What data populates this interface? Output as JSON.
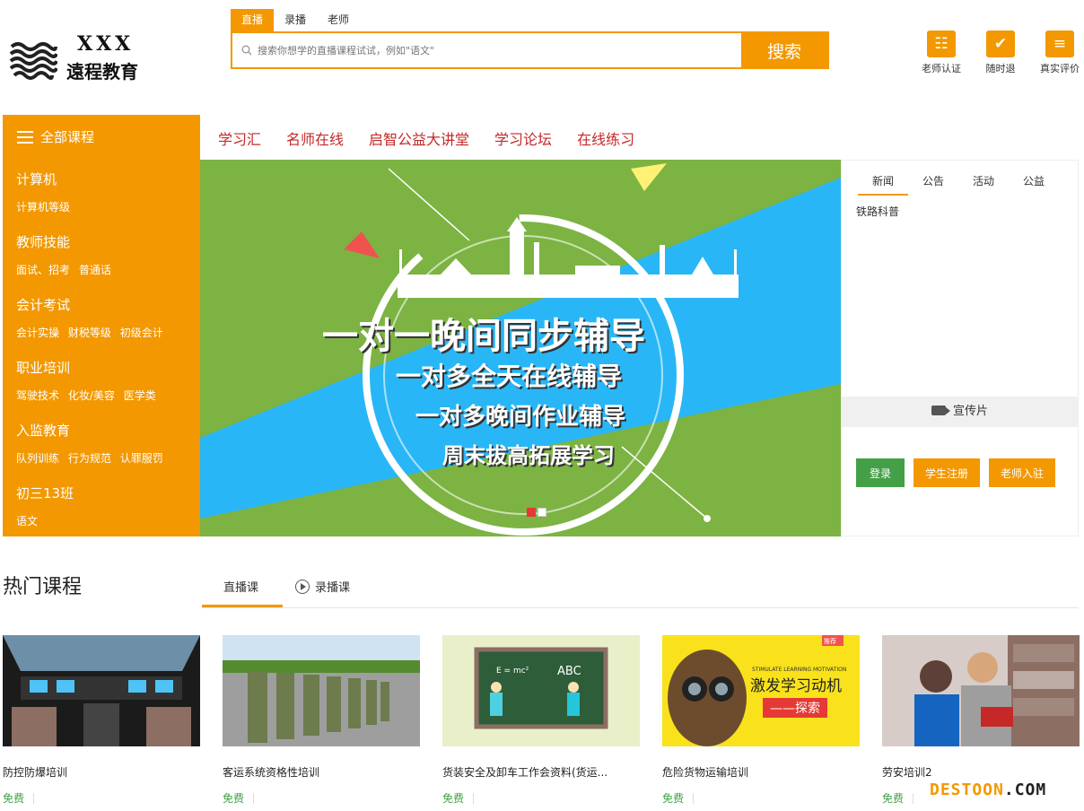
{
  "logo": {
    "line1": "XXX",
    "line2": "遠程教育"
  },
  "search": {
    "tabs": [
      "直播",
      "录播",
      "老师"
    ],
    "placeholder": "搜索你想学的直播课程试试，例如\"语文\"",
    "button": "搜索"
  },
  "features": [
    {
      "label": "老师认证",
      "icon": "teacher-certification-icon"
    },
    {
      "label": "随时退",
      "icon": "refund-icon"
    },
    {
      "label": "真实评价",
      "icon": "review-icon"
    }
  ],
  "nav": {
    "all_courses": "全部课程",
    "links": [
      "学习汇",
      "名师在线",
      "启智公益大讲堂",
      "学习论坛",
      "在线练习"
    ]
  },
  "sidebar": {
    "categories": [
      {
        "title": "计算机",
        "subs": [
          "计算机等级"
        ]
      },
      {
        "title": "教师技能",
        "subs": [
          "面试、招考",
          "普通话"
        ]
      },
      {
        "title": "会计考试",
        "subs": [
          "会计实操",
          "财税等级",
          "初级会计"
        ]
      },
      {
        "title": "职业培训",
        "subs": [
          "驾驶技术",
          "化妆/美容",
          "医学类"
        ]
      },
      {
        "title": "入监教育",
        "subs": [
          "队列训练",
          "行为规范",
          "认罪服罚"
        ]
      },
      {
        "title": "初三13班",
        "subs": [
          "语文"
        ]
      }
    ]
  },
  "banner": {
    "slogans": [
      "一对一晚间同步辅导",
      "一对多全天在线辅导",
      "一对多晚间作业辅导",
      "周末拔高拓展学习"
    ]
  },
  "news": {
    "tabs": [
      "新闻",
      "公告",
      "活动",
      "公益"
    ],
    "items": [
      "铁路科普"
    ],
    "promo": "宣传片",
    "buttons": {
      "login": "登录",
      "student_register": "学生注册",
      "teacher_join": "老师入驻"
    }
  },
  "hot": {
    "title": "热门课程",
    "tabs": [
      "直播课",
      "录播课"
    ],
    "courses": [
      {
        "title": "防控防爆培训",
        "price": "免费"
      },
      {
        "title": "客运系统资格性培训",
        "price": "免费"
      },
      {
        "title": "货装安全及卸车工作会资料(货运...",
        "price": "免费"
      },
      {
        "title": "危险货物运输培训",
        "price": "免费"
      },
      {
        "title": "劳安培训2",
        "price": "免费"
      }
    ],
    "thumb_texts": {
      "ad_tag": "推荐",
      "ad_caption": "STIMULATE LEARNING MOTIVATION",
      "ad_title": "激发学习动机",
      "ad_sub": "——探索",
      "board_formula": "E = mc²",
      "board_abc": "ABC"
    }
  },
  "watermark": {
    "part1": "DESTOON",
    "part2": ".COM"
  }
}
